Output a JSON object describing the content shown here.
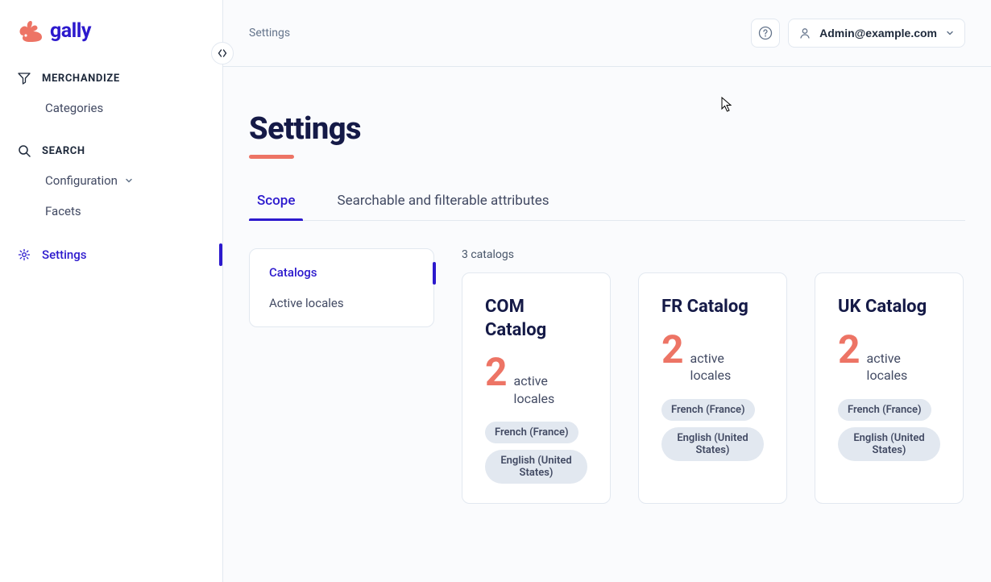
{
  "app": {
    "name": "gally"
  },
  "user": {
    "email": "Admin@example.com"
  },
  "sidebar": {
    "sections": [
      {
        "label": "MERCHANDIZE",
        "items": [
          {
            "label": "Categories"
          }
        ]
      },
      {
        "label": "SEARCH",
        "items": [
          {
            "label": "Configuration"
          },
          {
            "label": "Facets"
          }
        ]
      }
    ],
    "settings_label": "Settings"
  },
  "breadcrumb": "Settings",
  "page": {
    "title": "Settings"
  },
  "tabs": [
    {
      "label": "Scope",
      "active": true
    },
    {
      "label": "Searchable and filterable attributes",
      "active": false
    }
  ],
  "submenu": [
    {
      "label": "Catalogs",
      "active": true
    },
    {
      "label": "Active locales",
      "active": false
    }
  ],
  "catalogs": {
    "count_label": "3 catalogs",
    "active_locales_text": "active locales",
    "items": [
      {
        "title": "COM Catalog",
        "count": 2,
        "locales": [
          "French (France)",
          "English (United States)"
        ]
      },
      {
        "title": "FR Catalog",
        "count": 2,
        "locales": [
          "French (France)",
          "English (United States)"
        ]
      },
      {
        "title": "UK Catalog",
        "count": 2,
        "locales": [
          "French (France)",
          "English (United States)"
        ]
      }
    ]
  }
}
